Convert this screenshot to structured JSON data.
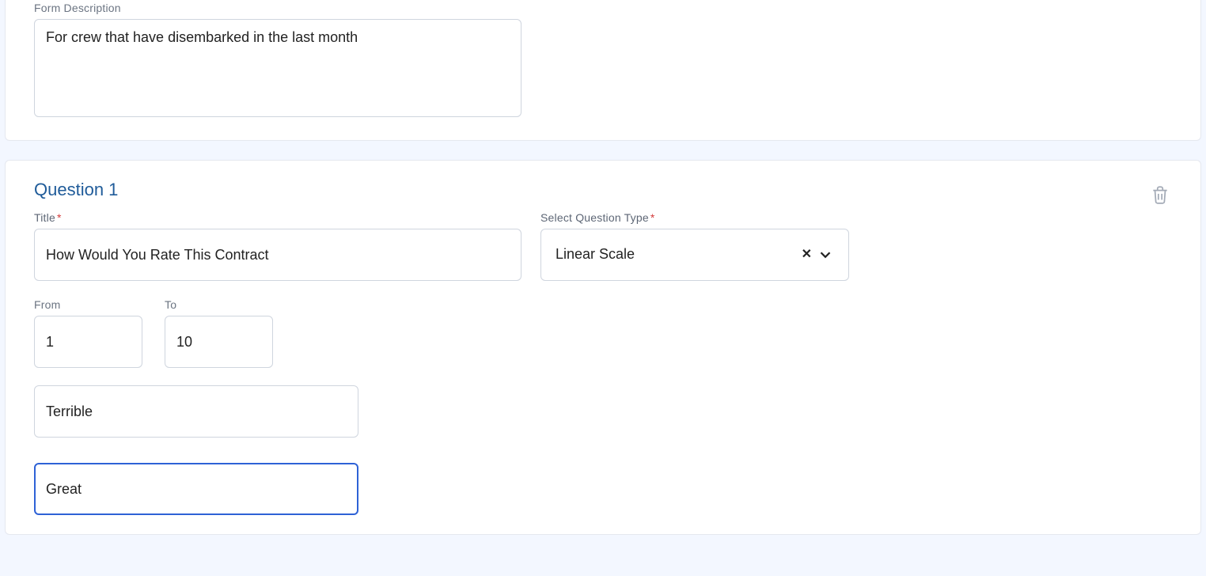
{
  "description": {
    "label": "Form Description",
    "value": "For crew that have disembarked in the last month"
  },
  "question": {
    "heading": "Question 1",
    "title_label": "Title",
    "title_value": "How Would You Rate This Contract",
    "type_label": "Select Question Type",
    "type_value": "Linear Scale",
    "from_label": "From",
    "from_value": "1",
    "to_label": "To",
    "to_value": "10",
    "low_label_value": "Terrible",
    "high_label_value": "Great"
  }
}
